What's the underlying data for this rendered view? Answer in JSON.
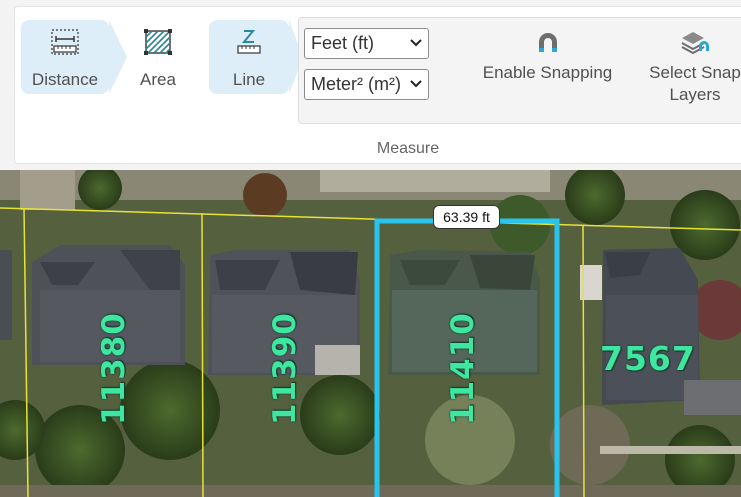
{
  "ribbon": {
    "tools": [
      {
        "label": "Distance",
        "icon": "distance-ruler-icon",
        "active": true
      },
      {
        "label": "Area",
        "icon": "area-hatch-icon",
        "active": false
      },
      {
        "label": "Line",
        "icon": "line-ruler-icon",
        "active": true
      }
    ],
    "length_unit": "Feet (ft)",
    "area_unit": "Meter² (m²)",
    "enable_snapping": "Enable Snapping",
    "select_snap_layers_line1": "Select Snap",
    "select_snap_layers_line2": "Layers",
    "group_label": "Measure",
    "active_color": "#deeef9"
  },
  "map": {
    "measurement": "63.39 ft",
    "parcels": [
      "11380",
      "11390",
      "11410",
      "7567"
    ],
    "highlight_color": "#29c4ec",
    "parcel_line_color": "#e6e23a",
    "label_color": "#3ee6a0"
  }
}
